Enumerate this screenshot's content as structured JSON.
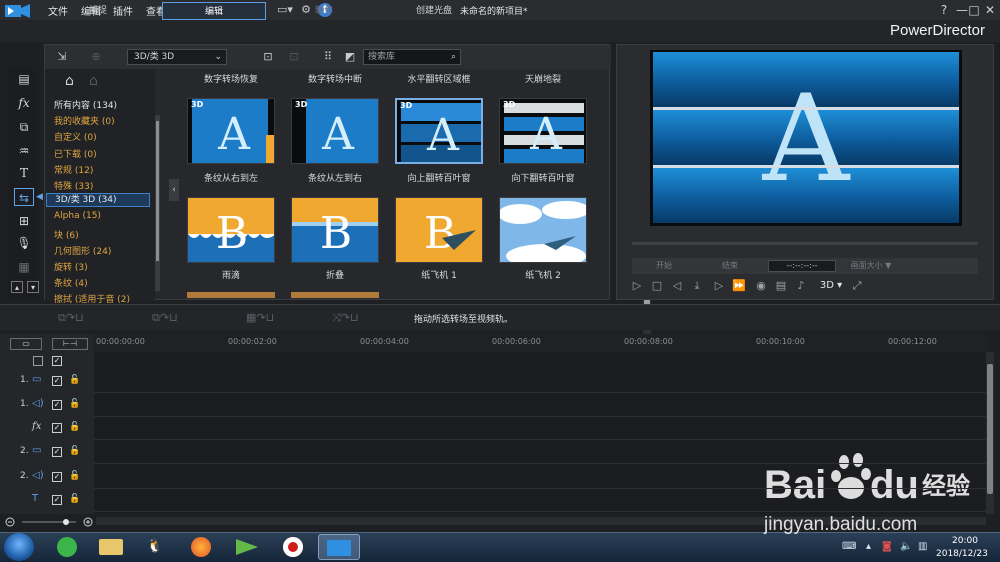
{
  "menu": [
    "文件",
    "编辑",
    "插件",
    "查看",
    "播放"
  ],
  "project_title": "未命名的新项目*",
  "window_controls": [
    "?",
    "—",
    "□",
    "✕"
  ],
  "modes": [
    {
      "label": "捕捉",
      "state": "normal"
    },
    {
      "label": "编辑",
      "state": "active"
    },
    {
      "label": "制作",
      "state": "disabled"
    },
    {
      "label": "创建光盘",
      "state": "normal"
    }
  ],
  "brand": "PowerDirector",
  "library": {
    "category": "3D/类 3D",
    "search_placeholder": "搜索库",
    "tree": [
      {
        "label": "所有内容 (134)",
        "style": "white"
      },
      {
        "label": "我的收藏夹 (0)",
        "style": "orange"
      },
      {
        "label": "自定义 (0)",
        "style": "orange"
      },
      {
        "label": "已下载 (0)",
        "style": "orange"
      },
      {
        "label": "常规 (12)",
        "style": "orange"
      },
      {
        "label": "特殊 (33)",
        "style": "orange"
      },
      {
        "label": "3D/类 3D (34)",
        "style": "selected"
      },
      {
        "label": "Alpha (15)",
        "style": "orange"
      },
      {
        "label": "块 (6)",
        "style": "orange"
      },
      {
        "label": "几何图形 (24)",
        "style": "orange"
      },
      {
        "label": "旋转 (3)",
        "style": "orange"
      },
      {
        "label": "条纹 (4)",
        "style": "orange"
      },
      {
        "label": "擦拭 (适用于音 (2)",
        "style": "orange"
      }
    ],
    "top_row_labels": [
      "数字转场恢复",
      "数字转场中断",
      "水平翻转区域框",
      "天崩地裂"
    ],
    "row1": [
      {
        "label": "条纹从右到左",
        "badge": "3D"
      },
      {
        "label": "条纹从左到右",
        "badge": "3D"
      },
      {
        "label": "向上翻转百叶窗",
        "badge": "3D"
      },
      {
        "label": "向下翻转百叶窗",
        "badge": "3D"
      }
    ],
    "row2": [
      {
        "label": "雨滴",
        "badge": ""
      },
      {
        "label": "折叠",
        "badge": ""
      },
      {
        "label": "纸飞机 1",
        "badge": ""
      },
      {
        "label": "纸飞机 2",
        "badge": ""
      }
    ],
    "thumb_letters": [
      "A",
      "B"
    ]
  },
  "preview": {
    "letter": "A",
    "buttons": [
      "开始",
      "结束",
      "画面大小 ▼"
    ],
    "timecode": "--:--:--:--",
    "mode_3d": "3D ▾"
  },
  "timeline": {
    "hint": "拖动所选转场至视频轨。",
    "ticks": [
      "00:00:00:00",
      "00:00:02:00",
      "00:00:04:00",
      "00:00:06:00",
      "00:00:08:00",
      "00:00:10:00",
      "00:00:12:00"
    ],
    "tracks": [
      {
        "label": "1.",
        "icon": "video"
      },
      {
        "label": "1.",
        "icon": "audio"
      },
      {
        "label": "",
        "icon": "fx"
      },
      {
        "label": "2.",
        "icon": "video"
      },
      {
        "label": "2.",
        "icon": "audio"
      },
      {
        "label": "",
        "icon": "title"
      }
    ]
  },
  "taskbar": {
    "time": "20:00",
    "date": "2018/12/23"
  },
  "watermark": {
    "brand": "Bai",
    "brand2": "du",
    "cn": "经验",
    "url": "jingyan.baidu.com"
  },
  "colors": {
    "accent": "#5a9de0",
    "category_orange": "#e0a640",
    "transition_blue": "#1d6fb8",
    "transition_orange": "#f0a830"
  }
}
